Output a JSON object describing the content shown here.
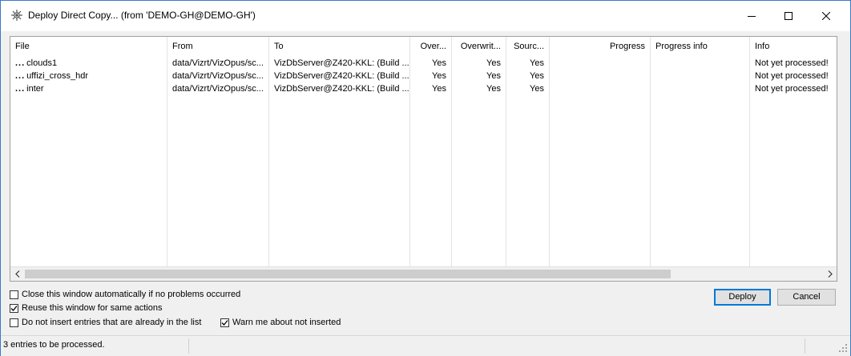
{
  "window": {
    "title": "Deploy Direct Copy... (from 'DEMO-GH@DEMO-GH')",
    "icon": "gear-cluster-icon",
    "controls": {
      "minimize": "minimize-icon",
      "maximize": "maximize-icon",
      "close": "close-icon"
    }
  },
  "table": {
    "columns": [
      "File",
      "From",
      "To",
      "Over...",
      "Overwrit...",
      "Sourc...",
      "Progress",
      "Progress info",
      "Info"
    ],
    "rows": [
      {
        "file": "clouds1",
        "from": "data/Vizrt/VizOpus/sc...",
        "to": "VizDbServer@Z420-KKL: (Build ...",
        "over": "Yes",
        "overwrit": "Yes",
        "sourc": "Yes",
        "progress": "",
        "progress_info": "",
        "info": "Not yet processed!"
      },
      {
        "file": "uffizi_cross_hdr",
        "from": "data/Vizrt/VizOpus/sc...",
        "to": "VizDbServer@Z420-KKL: (Build ...",
        "over": "Yes",
        "overwrit": "Yes",
        "sourc": "Yes",
        "progress": "",
        "progress_info": "",
        "info": "Not yet processed!"
      },
      {
        "file": "inter",
        "from": "data/Vizrt/VizOpus/sc...",
        "to": "VizDbServer@Z420-KKL: (Build ...",
        "over": "Yes",
        "overwrit": "Yes",
        "sourc": "Yes",
        "progress": "",
        "progress_info": "",
        "info": "Not yet processed!"
      }
    ],
    "row_prefix": "..."
  },
  "options": {
    "close_auto": {
      "label": "Close this window automatically if no problems occurred",
      "checked": false
    },
    "reuse_window": {
      "label": "Reuse this window for same actions",
      "checked": true
    },
    "no_insert_dupes": {
      "label": "Do not insert entries that are already in the list",
      "checked": false
    },
    "warn_not_inserted": {
      "label": "Warn me about not inserted",
      "checked": true
    }
  },
  "buttons": {
    "deploy": "Deploy",
    "cancel": "Cancel"
  },
  "status": {
    "text": "3 entries to be processed."
  },
  "colors": {
    "window_border": "#3c78c8",
    "accent": "#0078d7",
    "panel": "#f0f0f0"
  }
}
